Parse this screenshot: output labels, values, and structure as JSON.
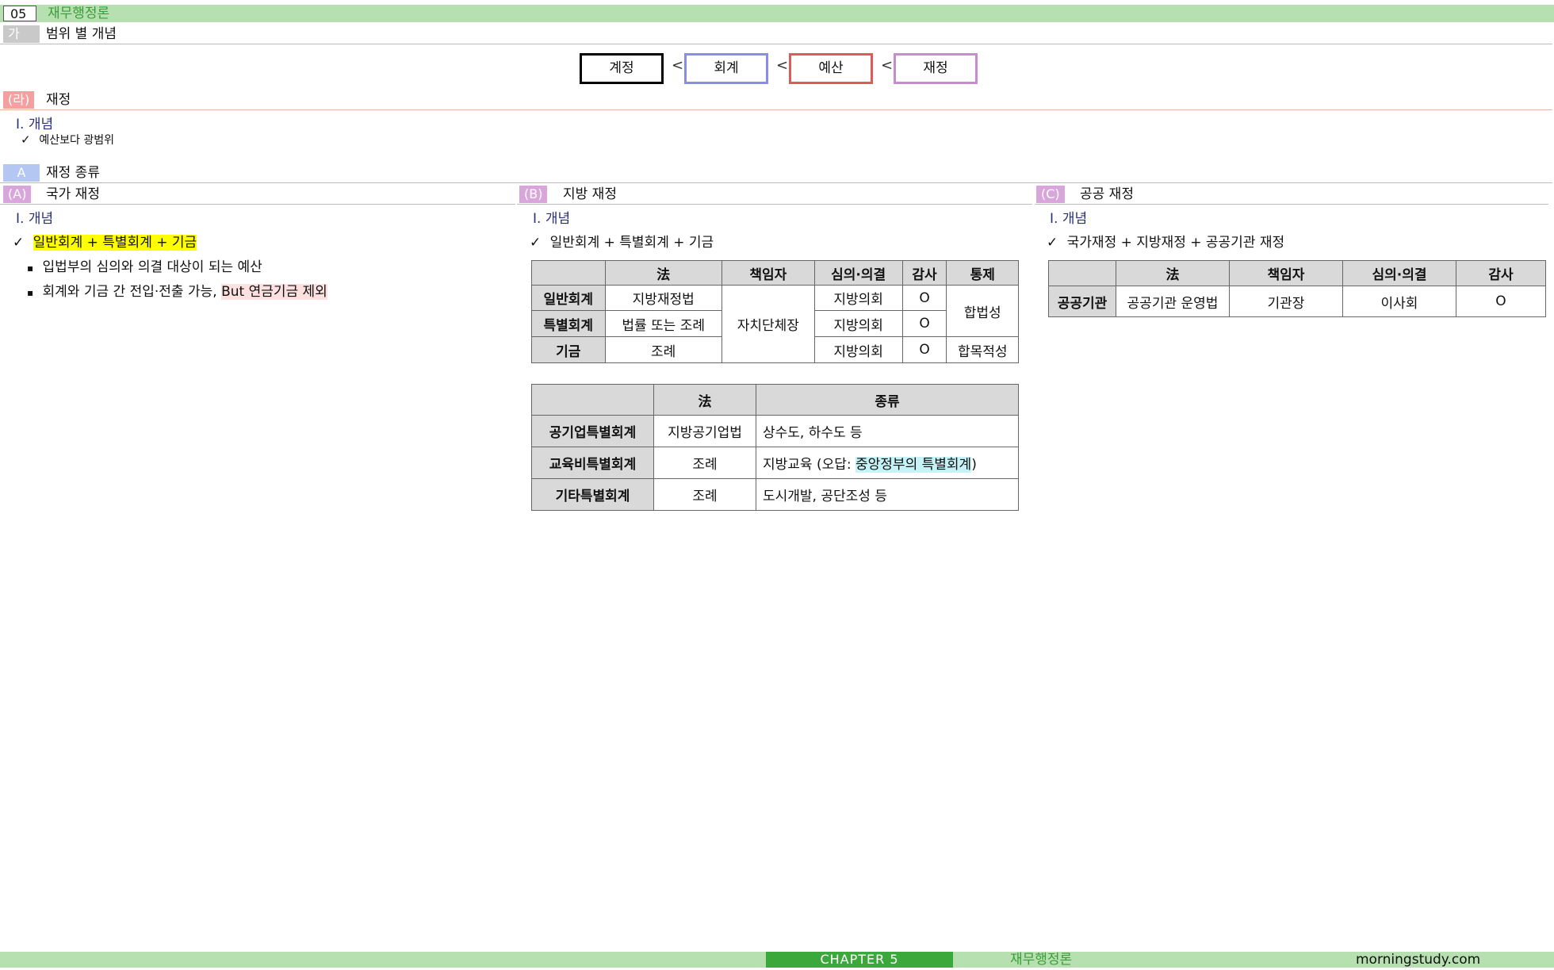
{
  "header": {
    "chapter_number": "05",
    "chapter_title": "재무행정론"
  },
  "section_ga": {
    "tag": "가",
    "title": "범위 별 개념"
  },
  "scope": {
    "items": [
      "계정",
      "회계",
      "예산",
      "재정"
    ],
    "separator": "<",
    "colors": [
      "#000000",
      "#8a8de8",
      "#e05a5a",
      "#c88ad0"
    ]
  },
  "section_ra": {
    "tag": "(라)",
    "title": "재정",
    "subhead": "Ⅰ. 개념",
    "check": "✓",
    "point": "예산보다 광범위"
  },
  "section_a": {
    "tag": "A",
    "title": "재정 종류"
  },
  "col_a": {
    "tag": "(A)",
    "title": "국가 재정",
    "subhead": "Ⅰ. 개념",
    "check": "✓",
    "main_point": "일반회계 + 특별회계 + 기금",
    "bullet": "▪",
    "bullet1": "입법부의 심의와 의결 대상이 되는 예산",
    "bullet2_pre": "회계와 기금 간 전입·전출 가능, ",
    "bullet2_hl": "But 연금기금 제외"
  },
  "col_b": {
    "tag": "(B)",
    "title": "지방 재정",
    "subhead": "Ⅰ. 개념",
    "check": "✓",
    "main_point": "일반회계 + 특별회계 + 기금",
    "table1": {
      "headers": [
        "法",
        "책임자",
        "심의·의결",
        "감사",
        "통제"
      ],
      "rows": [
        {
          "name": "일반회계",
          "law": "지방재정법",
          "council": "지방의회",
          "audit": "O"
        },
        {
          "name": "특별회계",
          "law": "법률 또는 조례",
          "council": "지방의회",
          "audit": "O"
        },
        {
          "name": "기금",
          "law": "조례",
          "council": "지방의회",
          "audit": "O"
        }
      ],
      "manager": "자치단체장",
      "control1": "합법성",
      "control2": "합목적성"
    },
    "table2": {
      "headers": [
        "法",
        "종류"
      ],
      "rows": [
        {
          "name": "공기업특별회계",
          "law": "지방공기업법",
          "kind": "상수도, 하수도 등"
        },
        {
          "name": "교육비특별회계",
          "law": "조례",
          "kind_pre": "지방교육 (오답: ",
          "kind_hl": "중앙정부의 특별회계",
          "kind_post": ")"
        },
        {
          "name": "기타특별회계",
          "law": "조례",
          "kind": "도시개발, 공단조성 등"
        }
      ]
    }
  },
  "col_c": {
    "tag": "(C)",
    "title": "공공 재정",
    "subhead": "Ⅰ. 개념",
    "check": "✓",
    "main_point": "국가재정 + 지방재정 + 공공기관 재정",
    "table": {
      "headers": [
        "法",
        "책임자",
        "심의·의결",
        "감사"
      ],
      "row": {
        "name": "공공기관",
        "law": "공공기관 운영법",
        "manager": "기관장",
        "council": "이사회",
        "audit": "O"
      }
    }
  },
  "footer": {
    "chapter": "CHAPTER 5",
    "title": "재무행정론",
    "site": "morningstudy.com"
  }
}
